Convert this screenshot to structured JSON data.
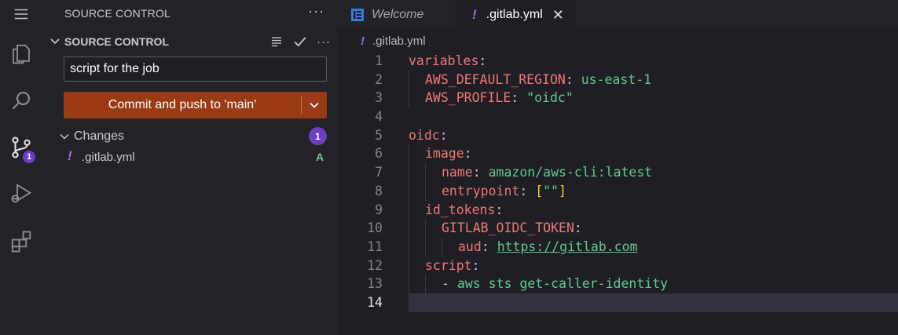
{
  "sidebar": {
    "title": "SOURCE CONTROL",
    "more": "···",
    "section_label": "SOURCE CONTROL",
    "commit_message": "script for the job",
    "commit_button": "Commit and push to 'main'",
    "changes_label": "Changes",
    "changes_count": "1",
    "files": [
      {
        "bang": "!",
        "name": ".gitlab.yml",
        "status": "A"
      }
    ]
  },
  "activity_bar": {
    "items": [
      "menu-icon",
      "explorer-icon",
      "search-icon",
      "source-control-icon",
      "run-debug-icon",
      "extensions-icon"
    ],
    "scm_badge": "1"
  },
  "tabs": [
    {
      "label": "Welcome",
      "active": false,
      "icon": "vscode-icon"
    },
    {
      "label": ".gitlab.yml",
      "active": true,
      "icon": "yaml-bang-icon",
      "close": "✕"
    }
  ],
  "breadcrumb": {
    "bang": "!",
    "label": ".gitlab.yml"
  },
  "editor": {
    "current_line": 14,
    "lines": [
      {
        "n": "1",
        "indent": 0,
        "parts": [
          {
            "c": "k",
            "t": "variables"
          },
          {
            "c": "p",
            "t": ":"
          }
        ]
      },
      {
        "n": "2",
        "indent": 1,
        "parts": [
          {
            "c": "k",
            "t": "AWS_DEFAULT_REGION"
          },
          {
            "c": "p",
            "t": ": "
          },
          {
            "c": "s",
            "t": "us-east-1"
          }
        ]
      },
      {
        "n": "3",
        "indent": 1,
        "parts": [
          {
            "c": "k",
            "t": "AWS_PROFILE"
          },
          {
            "c": "p",
            "t": ": "
          },
          {
            "c": "s",
            "t": "\"oidc\""
          }
        ]
      },
      {
        "n": "4",
        "indent": 0,
        "parts": []
      },
      {
        "n": "5",
        "indent": 0,
        "parts": [
          {
            "c": "k",
            "t": "oidc"
          },
          {
            "c": "p",
            "t": ":"
          }
        ]
      },
      {
        "n": "6",
        "indent": 1,
        "parts": [
          {
            "c": "k",
            "t": "image"
          },
          {
            "c": "p",
            "t": ":"
          }
        ]
      },
      {
        "n": "7",
        "indent": 2,
        "parts": [
          {
            "c": "k",
            "t": "name"
          },
          {
            "c": "p",
            "t": ": "
          },
          {
            "c": "s",
            "t": "amazon/aws-cli:latest"
          }
        ]
      },
      {
        "n": "8",
        "indent": 2,
        "parts": [
          {
            "c": "k",
            "t": "entrypoint"
          },
          {
            "c": "p",
            "t": ": "
          },
          {
            "c": "br",
            "t": "["
          },
          {
            "c": "s",
            "t": "\"\""
          },
          {
            "c": "br",
            "t": "]"
          }
        ]
      },
      {
        "n": "9",
        "indent": 1,
        "parts": [
          {
            "c": "k",
            "t": "id_tokens"
          },
          {
            "c": "p",
            "t": ":"
          }
        ]
      },
      {
        "n": "10",
        "indent": 2,
        "parts": [
          {
            "c": "k",
            "t": "GITLAB_OIDC_TOKEN"
          },
          {
            "c": "p",
            "t": ":"
          }
        ]
      },
      {
        "n": "11",
        "indent": 3,
        "parts": [
          {
            "c": "k",
            "t": "aud"
          },
          {
            "c": "p",
            "t": ": "
          },
          {
            "c": "u",
            "t": "https://gitlab.com"
          }
        ]
      },
      {
        "n": "12",
        "indent": 1,
        "parts": [
          {
            "c": "k",
            "t": "script"
          },
          {
            "c": "p",
            "t": ":"
          }
        ]
      },
      {
        "n": "13",
        "indent": 2,
        "parts": [
          {
            "c": "p",
            "t": "- "
          },
          {
            "c": "s",
            "t": "aws sts get-caller-identity"
          }
        ]
      },
      {
        "n": "14",
        "indent": 0,
        "parts": []
      }
    ]
  },
  "colors": {
    "accent": "#6c3fc4",
    "commit_button": "#9b3b16",
    "added": "#73c991"
  }
}
